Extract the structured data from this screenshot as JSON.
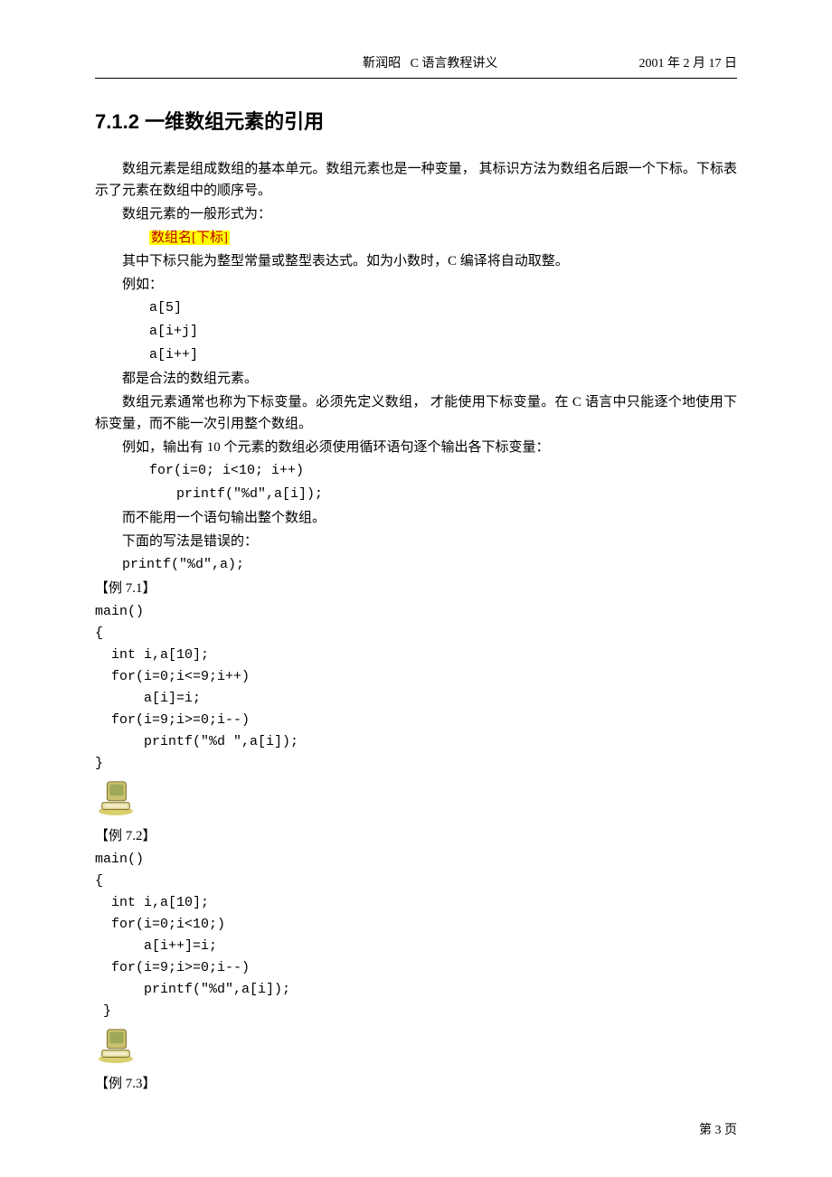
{
  "header": {
    "author": "靳润昭",
    "title": "C 语言教程讲义",
    "date": "2001 年 2 月 17 日"
  },
  "section": {
    "number": "7.1.2",
    "title": "一维数组元素的引用"
  },
  "body": {
    "p1": "数组元素是组成数组的基本单元。数组元素也是一种变量，  其标识方法为数组名后跟一个下标。下标表示了元素在数组中的顺序号。",
    "p2": "数组元素的一般形式为：",
    "form": "数组名[下标]",
    "p3": "其中下标只能为整型常量或整型表达式。如为小数时，C 编译将自动取整。",
    "p4": "例如：",
    "ex_a": "a[5]",
    "ex_b": "a[i+j]",
    "ex_c": "a[i++]",
    "p5": "都是合法的数组元素。",
    "p6": "数组元素通常也称为下标变量。必须先定义数组，  才能使用下标变量。在 C 语言中只能逐个地使用下标变量，而不能一次引用整个数组。",
    "p7": "例如，输出有 10 个元素的数组必须使用循环语句逐个输出各下标变量：",
    "for1": "for(i=0; i<10; i++)",
    "for2": "printf(\"%d\",a[i]);",
    "p8": "而不能用一个语句输出整个数组。",
    "p9": "下面的写法是错误的：",
    "wrong": "printf(\"%d\",a);"
  },
  "ex71": {
    "label": "【例 7.1】",
    "l1": "main()",
    "l2": "{",
    "l3": "  int i,a[10];",
    "l4": "  for(i=0;i<=9;i++)",
    "l5": "      a[i]=i;",
    "l6": "  for(i=9;i>=0;i--)",
    "l7": "      printf(\"%d \",a[i]);",
    "l8": "}"
  },
  "ex72": {
    "label": "【例 7.2】",
    "l1": "main()",
    "l2": "{",
    "l3": "  int i,a[10];",
    "l4": "  for(i=0;i<10;)",
    "l5": "      a[i++]=i;",
    "l6": "  for(i=9;i>=0;i--)",
    "l7": "      printf(\"%d\",a[i]);",
    "l8": " }"
  },
  "ex73": {
    "label": "【例 7.3】"
  },
  "footer": {
    "page": "第 3 页"
  }
}
